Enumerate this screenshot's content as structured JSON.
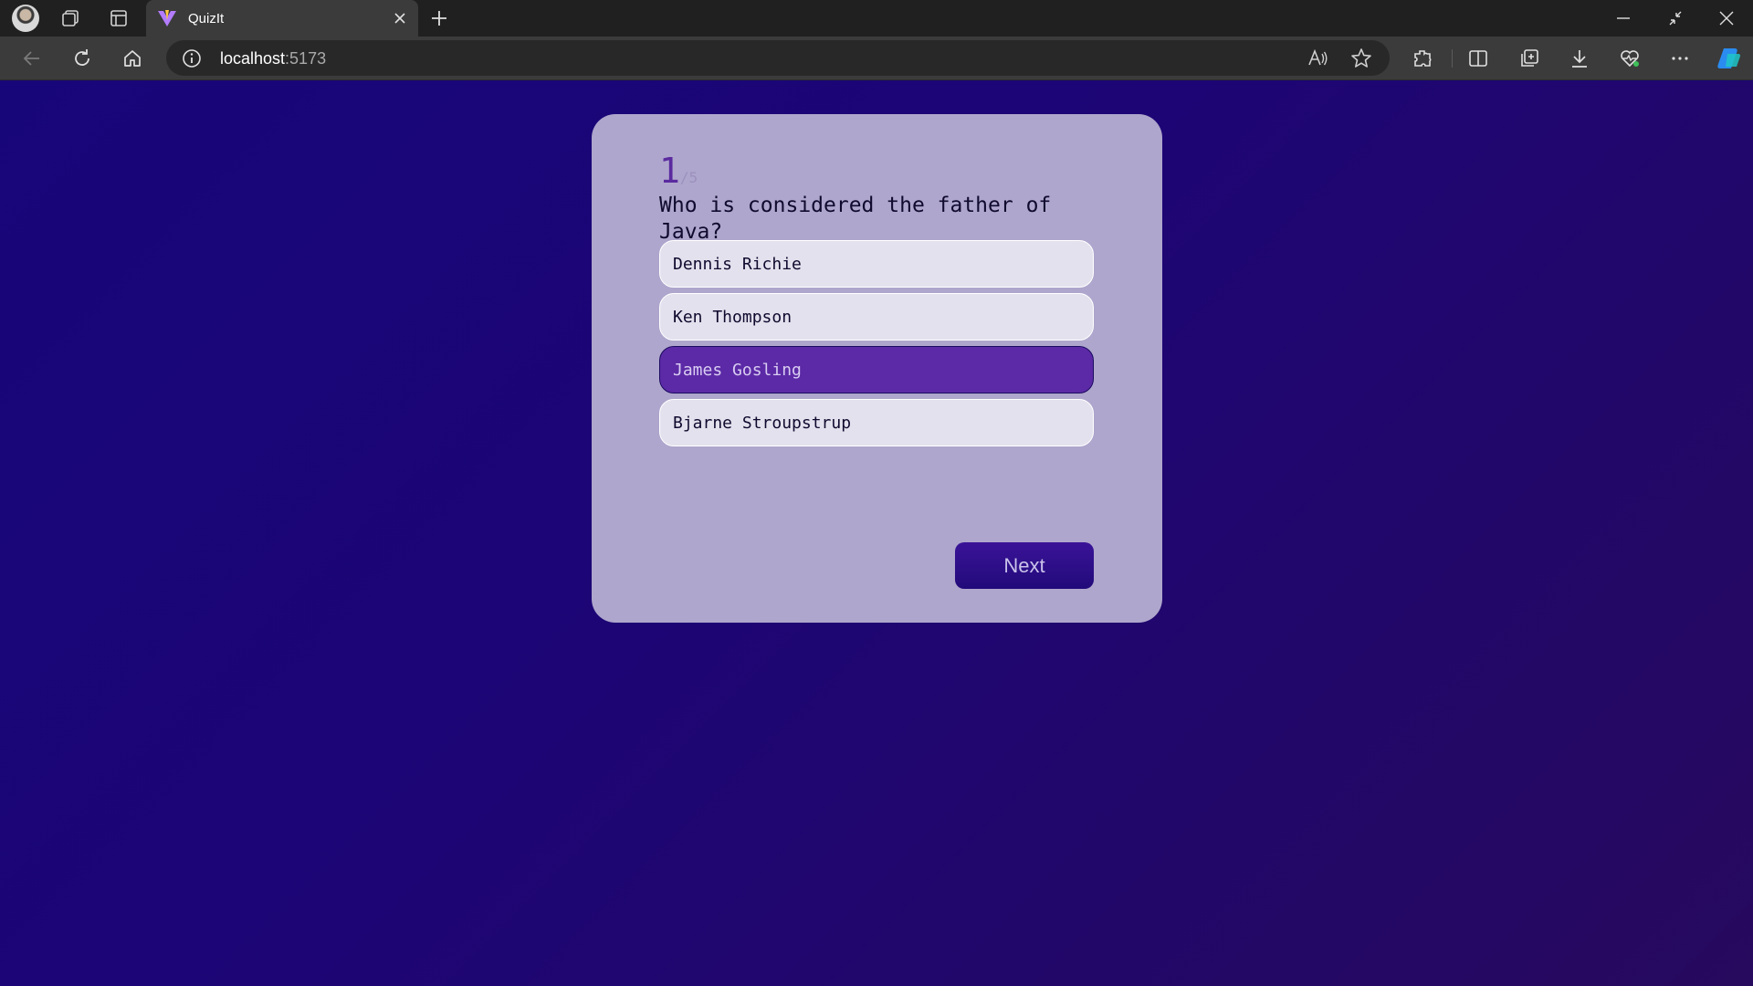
{
  "browser": {
    "tab_title": "QuizIt",
    "url_host": "localhost",
    "url_port": ":5173",
    "icons": [
      "profile-avatar",
      "workspaces-icon",
      "tab-actions-icon",
      "app-favicon",
      "close-tab-icon",
      "new-tab-icon",
      "minimize-icon",
      "restore-icon",
      "close-window-icon",
      "back-icon",
      "refresh-icon",
      "home-icon",
      "site-info-icon",
      "read-aloud-icon",
      "favorite-icon",
      "extensions-icon",
      "split-screen-icon",
      "collections-icon",
      "downloads-icon",
      "performance-icon",
      "more-icon",
      "copilot-icon"
    ]
  },
  "quiz": {
    "current": "1",
    "total": "/5",
    "question": "Who is considered the father of Java?",
    "options": [
      {
        "label": "Dennis Richie",
        "selected": false
      },
      {
        "label": "Ken Thompson",
        "selected": false
      },
      {
        "label": "James Gosling",
        "selected": true
      },
      {
        "label": "Bjarne Stroupstrup",
        "selected": false
      }
    ],
    "next_label": "Next"
  },
  "colors": {
    "background": "#1a0772",
    "card": "#aea6cc",
    "option": "#e4e1ee",
    "option_selected": "#5c2aa6",
    "next_button": "#2a0d86"
  }
}
